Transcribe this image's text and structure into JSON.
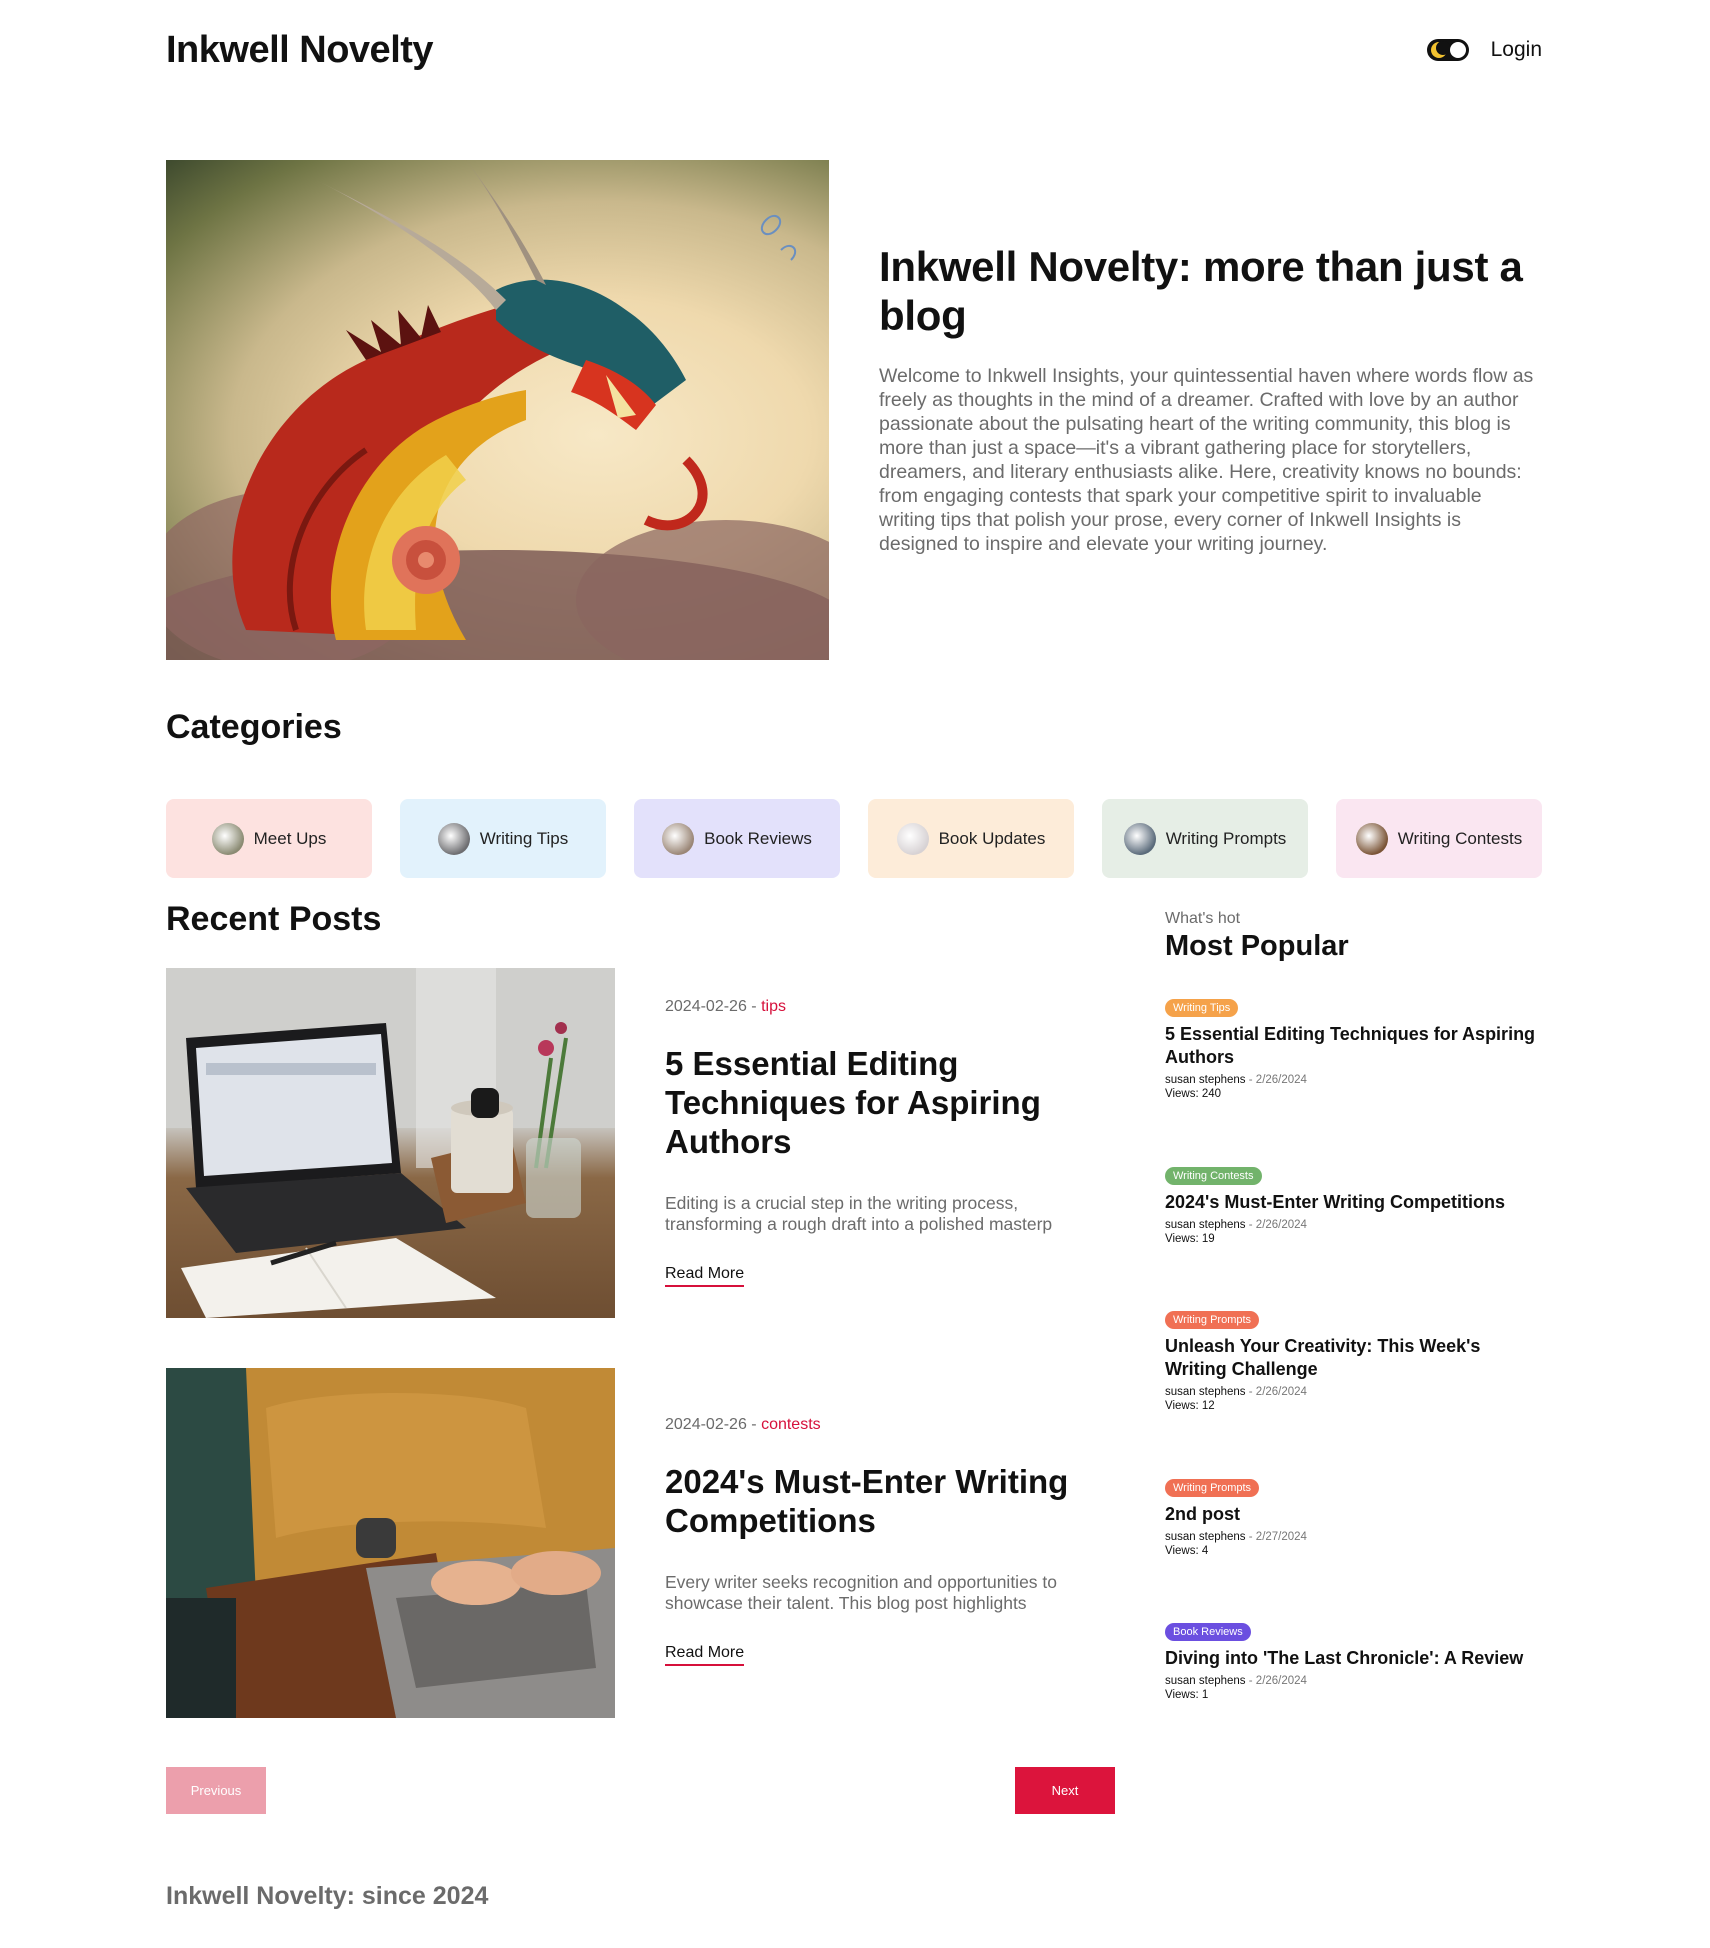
{
  "header": {
    "logo": "Inkwell Novelty",
    "login": "Login",
    "theme_toggle_icon": "moon-toggle-icon"
  },
  "hero": {
    "title": "Inkwell Novelty: more than just a blog",
    "body": "Welcome to Inkwell Insights, your quintessential haven where words flow as freely as thoughts in the mind of a dreamer. Crafted with love by an author passionate about the pulsating heart of the writing community, this blog is more than just a space—it's a vibrant gathering place for storytellers, dreamers, and literary enthusiasts alike. Here, creativity knows no bounds: from engaging contests that spark your competitive spirit to invaluable writing tips that polish your prose, every corner of Inkwell Insights is designed to inspire and elevate your writing journey."
  },
  "categories": {
    "title": "Categories",
    "items": [
      {
        "label": "Meet Ups",
        "bg": "#fde2e0",
        "thumb": "#8a8a72"
      },
      {
        "label": "Writing Tips",
        "bg": "#e2f2fc",
        "thumb": "#6d6d70"
      },
      {
        "label": "Book Reviews",
        "bg": "#e3e1fb",
        "thumb": "#9a8676"
      },
      {
        "label": "Book Updates",
        "bg": "#fdecd9",
        "thumb": "#d7d2d4"
      },
      {
        "label": "Writing Prompts",
        "bg": "#e6eee6",
        "thumb": "#5a6a7a"
      },
      {
        "label": "Writing Contests",
        "bg": "#fae6f1",
        "thumb": "#7a5436"
      }
    ]
  },
  "recent": {
    "title": "Recent Posts",
    "read_more": "Read More",
    "posts": [
      {
        "date": "2024-02-26",
        "sep": " - ",
        "category": "tips",
        "title": "5 Essential Editing Techniques for Aspiring Authors",
        "excerpt_1": "Editing is a crucial step in the writing process,",
        "excerpt_2": "transforming a rough draft into a polished masterp"
      },
      {
        "date": "2024-02-26",
        "sep": " - ",
        "category": "contests",
        "title": "2024's Must-Enter Writing Competitions",
        "excerpt_1": "Every writer seeks recognition and opportunities to",
        "excerpt_2": "showcase their talent. This blog post highlights"
      }
    ]
  },
  "popular": {
    "kicker": "What's hot",
    "title": "Most Popular",
    "items": [
      {
        "badge": "Writing Tips",
        "badge_color": "#f5a24a",
        "title": "5 Essential Editing Techniques for Aspiring Authors",
        "author": "susan stephens",
        "sep": " - ",
        "date": "2/26/2024",
        "views": "Views: 240"
      },
      {
        "badge": "Writing Contests",
        "badge_color": "#72b36b",
        "title": "2024's Must-Enter Writing Competitions",
        "author": "susan stephens",
        "sep": " - ",
        "date": "2/26/2024",
        "views": "Views: 19"
      },
      {
        "badge": "Writing Prompts",
        "badge_color": "#f07054",
        "title": "Unleash Your Creativity: This Week's Writing Challenge",
        "author": "susan stephens",
        "sep": " - ",
        "date": "2/26/2024",
        "views": "Views: 12"
      },
      {
        "badge": "Writing Prompts",
        "badge_color": "#f07054",
        "title": "2nd post",
        "author": "susan stephens",
        "sep": " - ",
        "date": "2/27/2024",
        "views": "Views: 4"
      },
      {
        "badge": "Book Reviews",
        "badge_color": "#6b4fe0",
        "title": "Diving into 'The Last Chronicle': A Review",
        "author": "susan stephens",
        "sep": " - ",
        "date": "2/26/2024",
        "views": "Views: 1"
      }
    ]
  },
  "pagination": {
    "previous": "Previous",
    "next": "Next"
  },
  "footer": {
    "text": "Inkwell Novelty: since 2024"
  }
}
